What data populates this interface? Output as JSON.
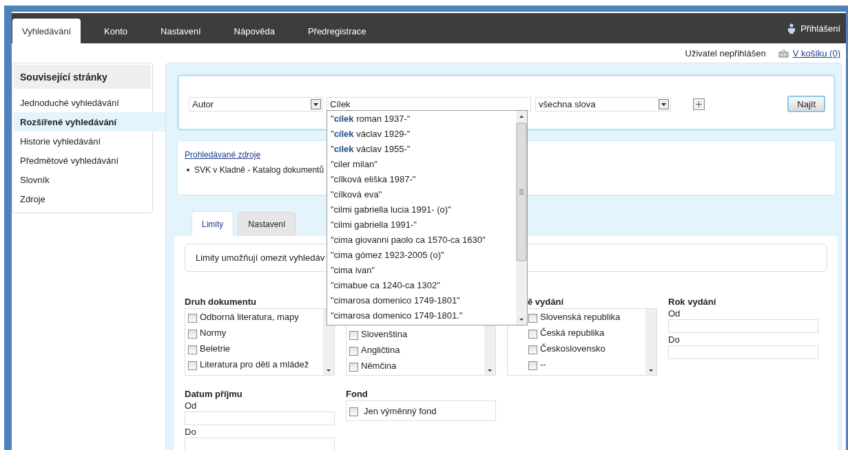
{
  "nav": {
    "tabs": [
      {
        "label": "Vyhledávání",
        "selected": true
      },
      {
        "label": "Konto",
        "selected": false
      },
      {
        "label": "Nastavení",
        "selected": false
      },
      {
        "label": "Nápověda",
        "selected": false
      },
      {
        "label": "Předregistrace",
        "selected": false
      }
    ],
    "login": "Přihlášení"
  },
  "user_bar": {
    "status": "Uživatel nepřihlášen",
    "cart_link": "V košíku (0)"
  },
  "sidebar": {
    "title": "Související stránky",
    "items": [
      {
        "label": "Jednoduché vyhledávání",
        "selected": false
      },
      {
        "label": "Rozšířené vyhledávání",
        "selected": true
      },
      {
        "label": "Historie vyhledávání",
        "selected": false
      },
      {
        "label": "Předmětové vyhledávání",
        "selected": false
      },
      {
        "label": "Slovník",
        "selected": false
      },
      {
        "label": "Zdroje",
        "selected": false
      }
    ]
  },
  "search": {
    "field_select": "Autor",
    "query": "Cílek",
    "mode_select": "všechna slova",
    "submit": "Najít"
  },
  "suggestions": [
    {
      "text": "\"**cílek** roman 1937-\"",
      "selected": false
    },
    {
      "text": "\"**cílek** václav 1929-\"",
      "selected": false
    },
    {
      "text": "\"**cílek** václav 1955-\"",
      "selected": false
    },
    {
      "text": "\"ciler milan\"",
      "selected": false
    },
    {
      "text": "\"cílková eliška 1987-\"",
      "selected": false
    },
    {
      "text": "\"cílková eva\"",
      "selected": false
    },
    {
      "text": "\"cilmi gabriella lucia 1991- (o)\"",
      "selected": false
    },
    {
      "text": "\"cilmi gabriella 1991-\"",
      "selected": false
    },
    {
      "text": "\"cima giovanni paolo ca 1570-ca 1630\"",
      "selected": false
    },
    {
      "text": "\"cima gómez 1923-2005 (o)\"",
      "selected": false
    },
    {
      "text": "\"cima ivan\"",
      "selected": false
    },
    {
      "text": "\"cimabue ca 1240-ca 1302\"",
      "selected": false
    },
    {
      "text": "\"cimarosa domenico 1749-1801\"",
      "selected": false
    },
    {
      "text": "\"cimarosa domenico 1749-1801.\"",
      "selected": false
    }
  ],
  "sources": {
    "title": "Prohledávané zdroje",
    "items": [
      "SVK v Kladně - Katalog dokumentů"
    ]
  },
  "limit_tabs": [
    {
      "label": "Limity",
      "selected": true
    },
    {
      "label": "Nastavení",
      "selected": false
    }
  ],
  "info": "Limity umožňují omezit vyhledáv",
  "filters": [
    {
      "kind": "checklist",
      "title": "Druh dokumentu",
      "options": [
        {
          "label": "Odborná literatura, mapy",
          "checked": false
        },
        {
          "label": "Normy",
          "checked": false
        },
        {
          "label": "Beletrie",
          "checked": false
        },
        {
          "label": "Literatura pro děti a mládež",
          "checked": false
        }
      ]
    },
    {
      "kind": "checklist",
      "options": [
        {
          "label": "Slovenština",
          "checked": false
        },
        {
          "label": "Angličtina",
          "checked": false
        },
        {
          "label": "Němčina",
          "checked": false
        }
      ]
    },
    {
      "kind": "checklist",
      "title": "ě vydání",
      "options": [
        {
          "label": "Slovenská republika",
          "checked": false
        },
        {
          "label": "Česká republika",
          "checked": false
        },
        {
          "label": "Československo",
          "checked": false
        },
        {
          "label": "--",
          "checked": false
        }
      ]
    },
    {
      "kind": "range",
      "title": "Rok vydání",
      "from_label": "Od",
      "to_label": "Do"
    },
    {
      "kind": "range",
      "title": "Datum příjmu",
      "from_label": "Od",
      "to_label": "Do"
    },
    {
      "kind": "checkbox",
      "title": "Fond",
      "options": [
        {
          "label": "Jen výměnný fond",
          "checked": false
        }
      ]
    }
  ]
}
